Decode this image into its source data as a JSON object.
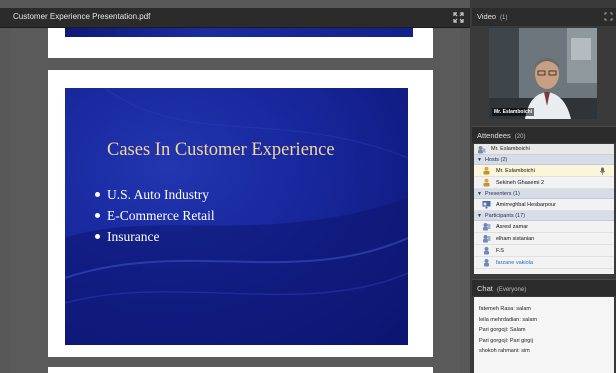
{
  "document": {
    "title": "Customer Experience Presentation.pdf",
    "slide": {
      "title": "Cases In Customer Experience",
      "bullets": [
        "U.S. Auto Industry",
        "E-Commerce Retail",
        "Insurance"
      ]
    },
    "icons": {
      "expand": "expand-icon"
    }
  },
  "video": {
    "title": "Video",
    "count": "(1)",
    "speaker_name": "Mr. Eslamboichi"
  },
  "attendees": {
    "title": "Attendees",
    "count": "(20)",
    "current_user": "Mr. Eslamboichi",
    "groups": [
      {
        "label": "Hosts (2)",
        "users": [
          "Mr. Eslamboichi",
          "Sekineh Ghasemi 2"
        ]
      },
      {
        "label": "Presenters (1)",
        "users": [
          "Amirreghbal Hesbarpour"
        ]
      },
      {
        "label": "Participants (17)",
        "users": [
          "Asresl zamar",
          "elham sistanian",
          "F.S",
          "farzane vakiola"
        ]
      }
    ]
  },
  "chat": {
    "title": "Chat",
    "scope": "(Everyone)",
    "messages": [
      "fatemeh Rasa: salam",
      "leila mehrdadian: salam",
      "Pari gorgoji: Salam",
      "Pari gorgoji: Pari girgij",
      "shokoh rahmani: sim"
    ]
  },
  "colors": {
    "slide_background": "#17269a",
    "slide_title": "#f1d79a",
    "panel_header": "#2c2c2c",
    "link_user": "#2a6bbf"
  }
}
